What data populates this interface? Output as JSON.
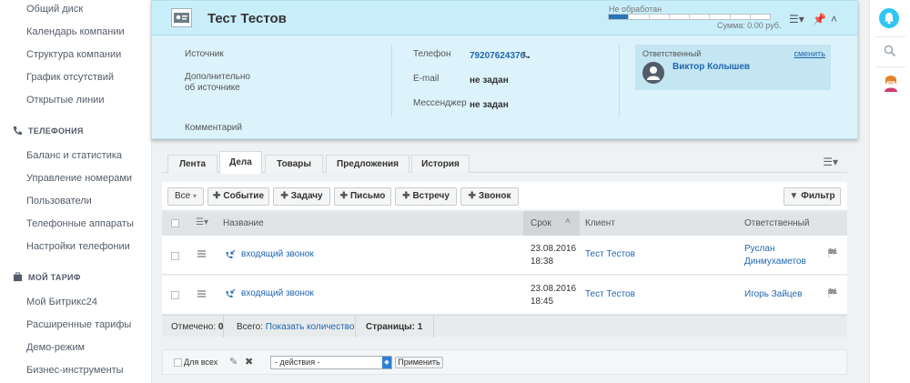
{
  "sidebar": {
    "items_top": [
      "Общий диск",
      "Календарь компании",
      "Структура компании",
      "График отсутствий",
      "Открытые линии"
    ],
    "section_telephony": "ТЕЛЕФОНИЯ",
    "items_telephony": [
      "Баланс и статистика",
      "Управление номерами",
      "Пользователи",
      "Телефонные аппараты",
      "Настройки телефонии"
    ],
    "section_tariff": "МОЙ ТАРИФ",
    "items_tariff": [
      "Мой Битрикс24",
      "Расширенные тарифы",
      "Демо-режим",
      "Бизнес-инструменты"
    ]
  },
  "card": {
    "title": "Тест Тестов",
    "status_label": "Не обработан",
    "progress_fraction": 0.125,
    "sum_label": "Сумма: 0.00 руб.",
    "fields": {
      "source_label": "Источник",
      "source_extra_label_1": "Дополнительно",
      "source_extra_label_2": "об источнике",
      "comment_label": "Комментарий",
      "phone_label": "Телефон",
      "phone_value": "79207624376",
      "email_label": "E-mail",
      "email_value": "не задан",
      "messenger_label": "Мессенджер",
      "messenger_value": "не задан"
    },
    "responsible": {
      "label": "Ответственный",
      "change_link": "сменить",
      "name": "Виктор Колышев"
    }
  },
  "tabs": [
    "Лента",
    "Дела",
    "Товары",
    "Предложения",
    "История"
  ],
  "active_tab": "Дела",
  "toolbar": {
    "filter_all": "Все",
    "add_event": "Событие",
    "add_task": "Задачу",
    "add_letter": "Письмо",
    "add_meeting": "Встречу",
    "add_call": "Звонок",
    "filter_button": "Фильтр"
  },
  "grid": {
    "headers": {
      "name": "Название",
      "deadline": "Срок",
      "client": "Клиент",
      "responsible": "Ответственный"
    },
    "rows": [
      {
        "name": "входящий звонок",
        "date": "23.08.2016",
        "time": "18:38",
        "client": "Тест Тестов",
        "resp_line1": "Руслан",
        "resp_line2": "Динмухаметов"
      },
      {
        "name": "входящий звонок",
        "date": "23.08.2016",
        "time": "18:45",
        "client": "Тест Тестов",
        "resp_line1": "Игорь Зайцев",
        "resp_line2": ""
      }
    ],
    "footer": {
      "selected_label": "Отмечено:",
      "selected_value": "0",
      "total_label": "Всего:",
      "total_link": "Показать количество",
      "pages_label": "Страницы:",
      "pages_value": "1"
    },
    "actions": {
      "for_all": "Для всех",
      "select_value": "- действия -",
      "apply": "Применить"
    }
  },
  "colors": {
    "accent": "#2067b0",
    "card_bg": "#dcf3fb",
    "progress": "#2a73b6",
    "notification": "#2fc6f6"
  }
}
